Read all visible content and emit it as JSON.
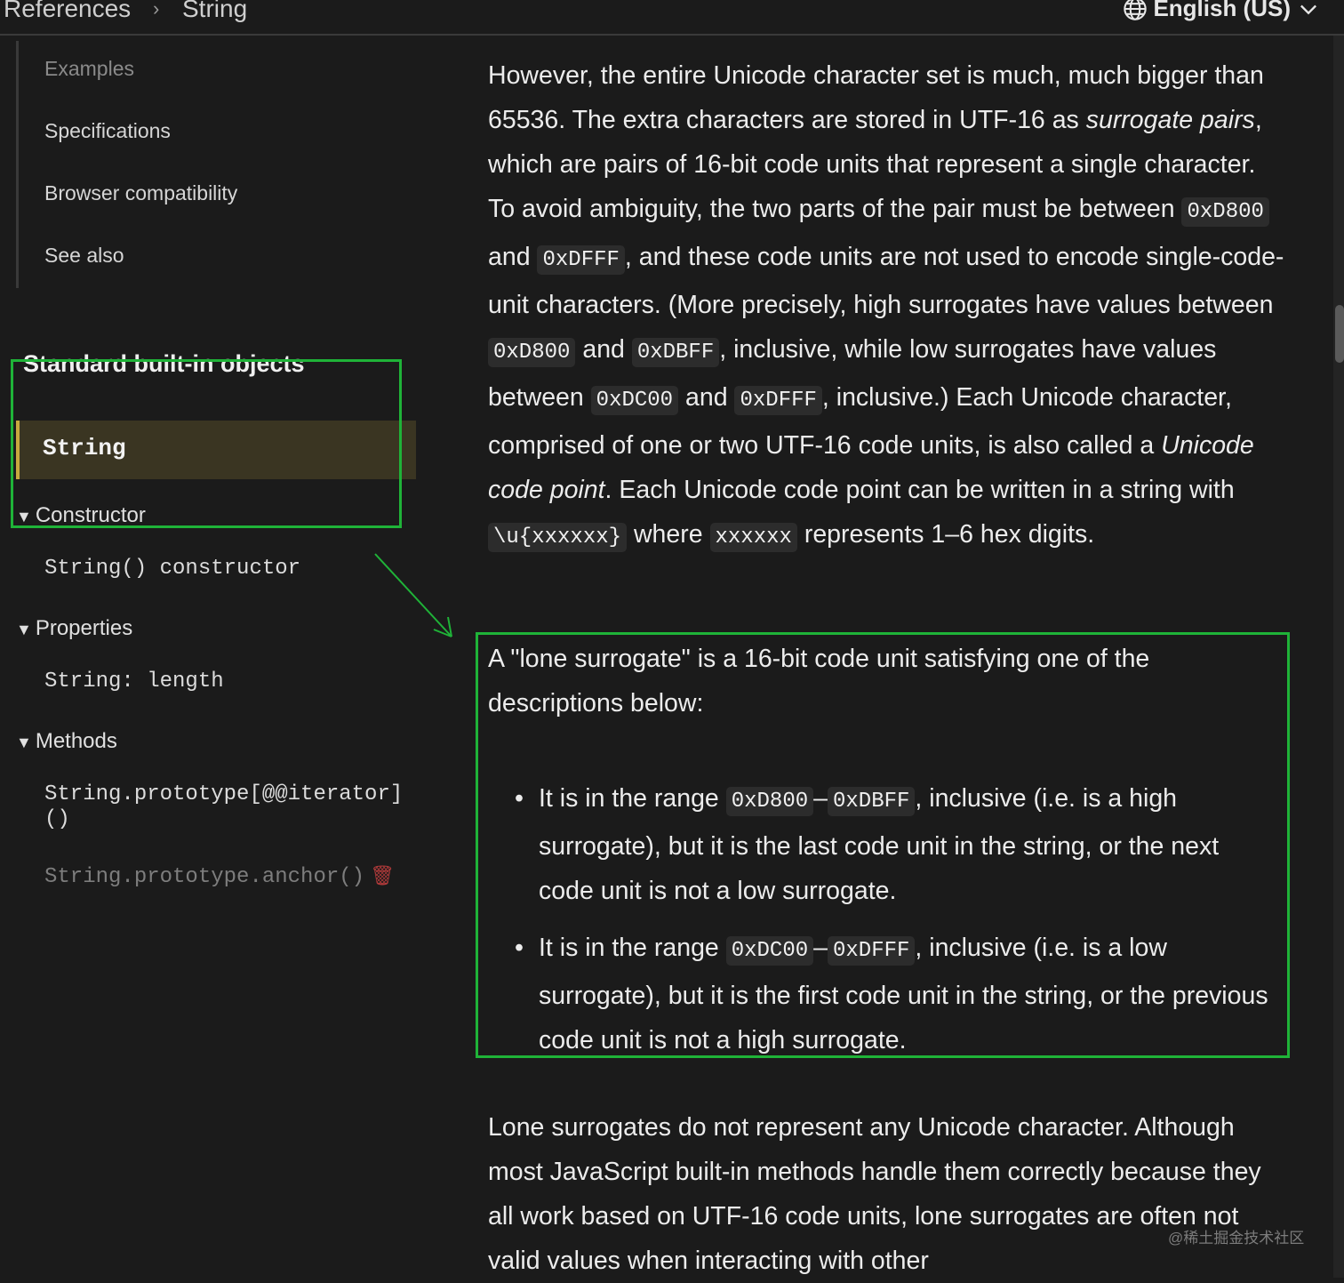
{
  "breadcrumb": {
    "items": [
      "References",
      "String"
    ],
    "separator": "›"
  },
  "language": {
    "label": "English (US)"
  },
  "sidebar": {
    "toc": [
      "Examples",
      "Specifications",
      "Browser compatibility",
      "See also"
    ],
    "section_title": "Standard built-in objects",
    "current": "String",
    "groups": {
      "constructor": {
        "label": "Constructor",
        "items": [
          "String() constructor"
        ]
      },
      "properties": {
        "label": "Properties",
        "items": [
          "String: length"
        ]
      },
      "methods": {
        "label": "Methods",
        "items": [
          "String.prototype[@@iterator]()",
          "String.prototype.anchor()"
        ]
      }
    }
  },
  "content": {
    "p1": {
      "a": "However, the entire Unicode character set is much, much bigger than 65536. The extra characters are stored in UTF-16 as ",
      "b": "surrogate pairs",
      "c": ", which are pairs of 16-bit code units that represent a single character. To avoid ambiguity, the two parts of the pair must be between ",
      "d": "0xD800",
      "e": " and ",
      "f": "0xDFFF",
      "g": ", and these code units are not used to encode single-code-unit characters. (More precisely, high surrogates have values between ",
      "h": "0xD800",
      "i": " and ",
      "j": "0xDBFF",
      "k": ", inclusive, while low surrogates have values between ",
      "l": "0xDC00",
      "m": " and ",
      "n": "0xDFFF",
      "o": ", inclusive.) Each Unicode character, comprised of one or two UTF-16 code units, is also called a ",
      "p": "Unicode code point",
      "q": ". Each Unicode code point can be written in a string with ",
      "r": "\\u{xxxxxx}",
      "s": " where ",
      "t": "xxxxxx",
      "u": " represents 1–6 hex digits."
    },
    "p2": "A \"lone surrogate\" is a 16-bit code unit satisfying one of the descriptions below:",
    "bullets": [
      {
        "a": "It is in the range ",
        "b": "0xD800",
        "c": "–",
        "d": "0xDBFF",
        "e": ", inclusive (i.e. is a high surrogate), but it is the last code unit in the string, or the next code unit is not a low surrogate."
      },
      {
        "a": "It is in the range ",
        "b": "0xDC00",
        "c": "–",
        "d": "0xDFFF",
        "e": ", inclusive (i.e. is a low surrogate), but it is the first code unit in the string, or the previous code unit is not a high surrogate."
      }
    ],
    "p3": "Lone surrogates do not represent any Unicode character. Although most JavaScript built-in methods handle them correctly because they all work based on UTF-16 code units, lone surrogates are often not valid values when interacting with other"
  },
  "watermark": "@稀土掘金技术社区",
  "colors": {
    "highlight_box": "#1fb338",
    "current_accent": "#c8a93e",
    "background": "#1b1b1b"
  },
  "icons": [
    "chevron-right-icon",
    "globe-icon",
    "chevron-down-icon",
    "triangle-down-icon",
    "trash-icon",
    "arrow-icon"
  ]
}
